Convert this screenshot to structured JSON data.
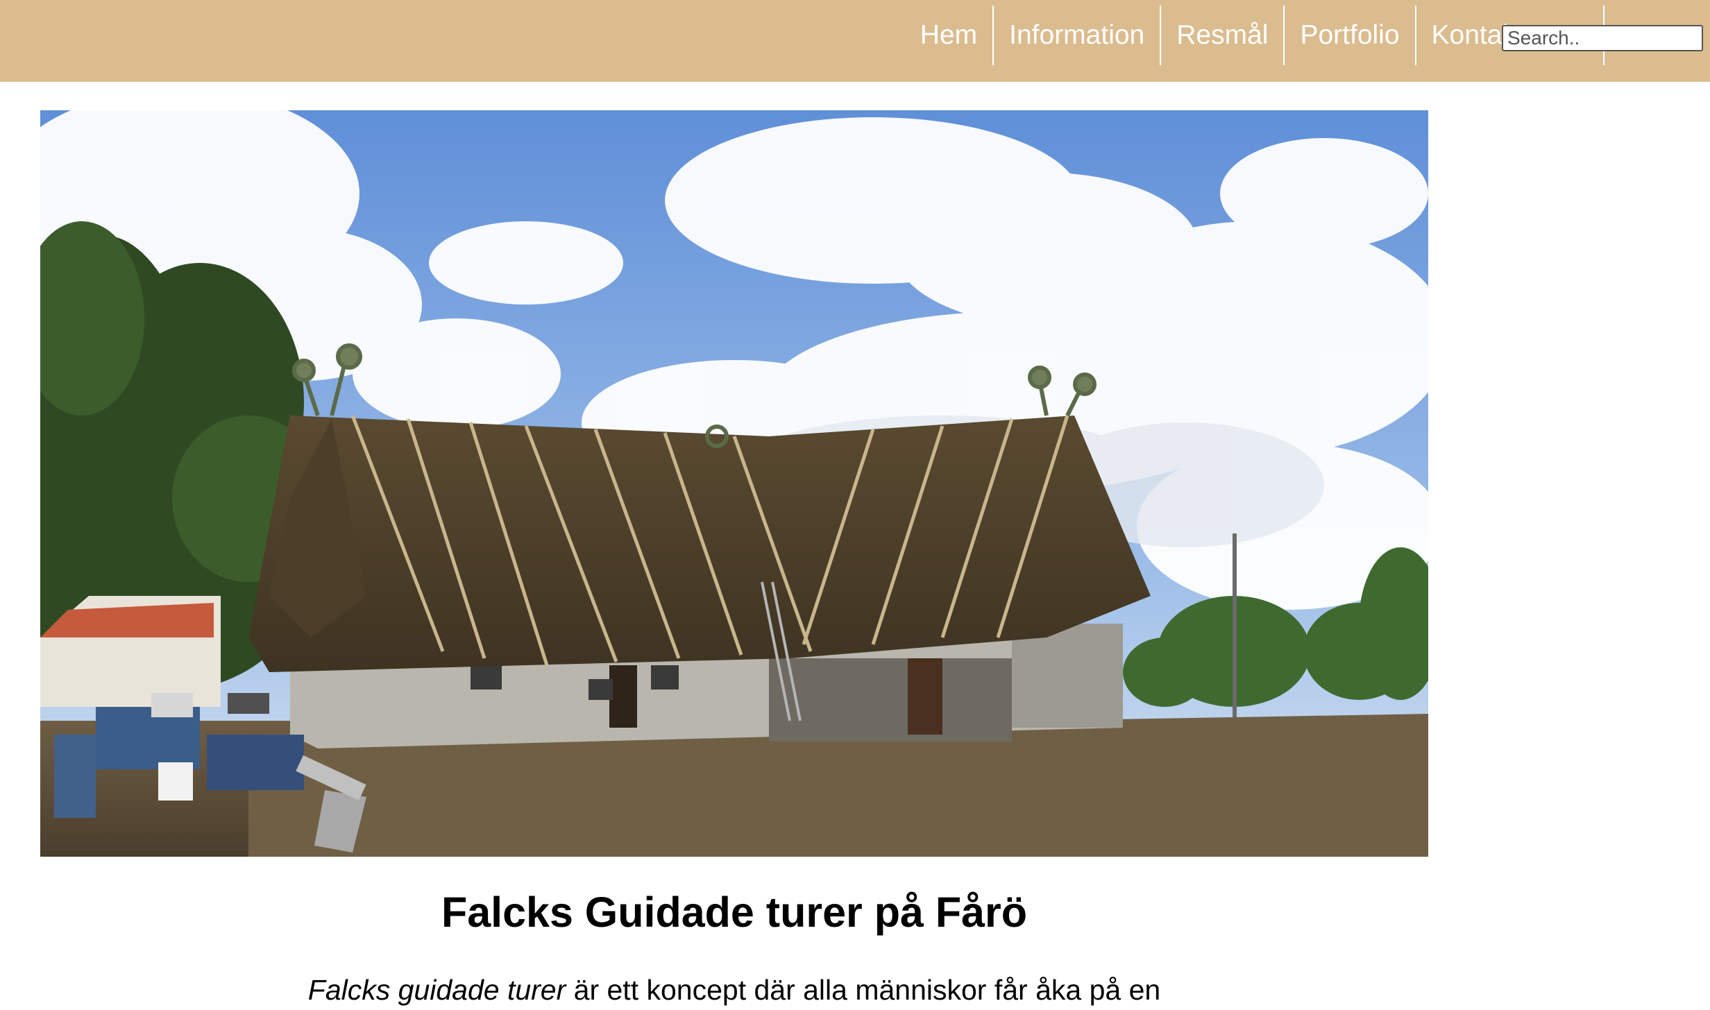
{
  "nav": {
    "items": [
      {
        "label": "Hem"
      },
      {
        "label": "Information"
      },
      {
        "label": "Resmål"
      },
      {
        "label": "Portfolio"
      },
      {
        "label": "Kontakta oss"
      }
    ]
  },
  "search": {
    "placeholder": "Search.."
  },
  "main": {
    "title": "Falcks Guidade turer på Fårö",
    "intro_emphasis": "Falcks guidade turer",
    "intro_text": " är ett koncept där alla människor får åka på en"
  },
  "colors": {
    "header_bg": "#dbbc8f",
    "nav_text": "#ffffff"
  }
}
